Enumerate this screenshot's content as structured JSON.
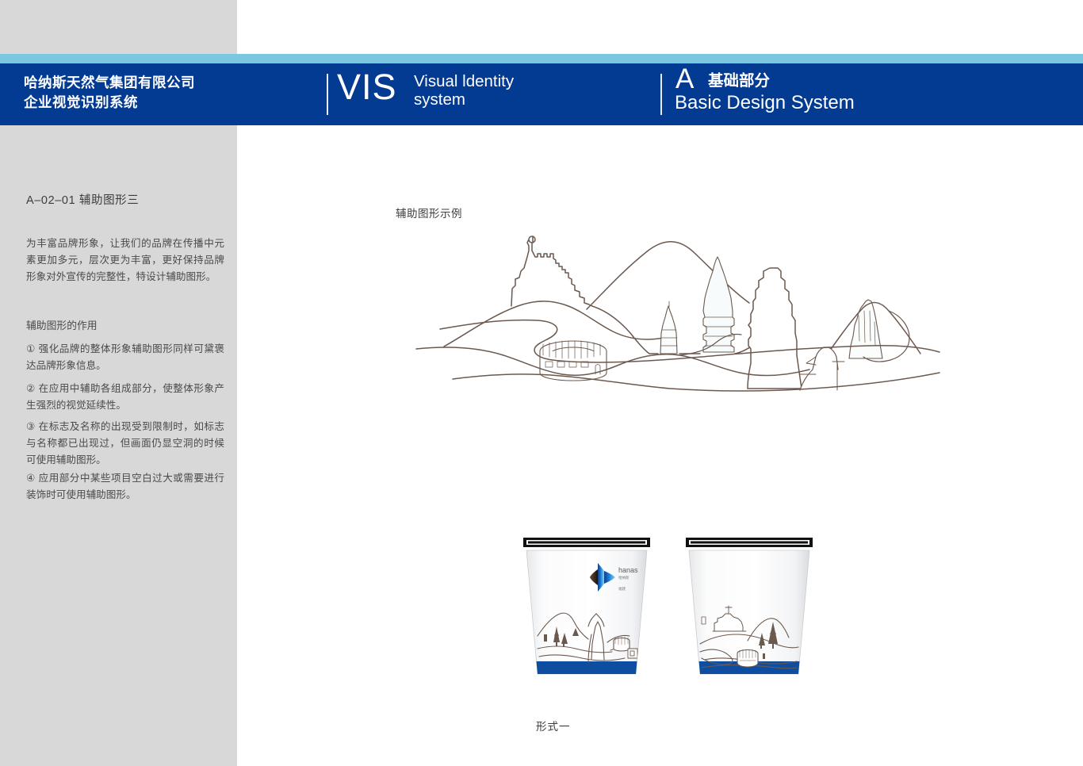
{
  "colors": {
    "navy": "#033b92",
    "light_blue": "#79c8e0",
    "panel_gray": "#d8d8d8",
    "line_brown": "#6b594e",
    "cup_band_blue": "#0d4ea0",
    "text_gray": "#4a4a4a"
  },
  "header": {
    "company_name": "哈纳斯天然气集团有限公司\n企业视觉识别系统",
    "vis_word": "VIS",
    "vis_subtitle": "Visual ldentity\nsystem",
    "section_letter": "A",
    "section_cn": "基础部分",
    "section_en": "Basic Design System"
  },
  "sidebar": {
    "page_code_title": "A–02–01 辅助图形三",
    "intro": "为丰富品牌形象，让我们的品牌在传播中元素更加多元，层次更为丰富，更好保持品牌形象对外宣传的完整性，特设计辅助图形。",
    "role_heading": "辅助图形的作用",
    "items": [
      "①  强化品牌的整体形象辅助图形同样可黛褒达品牌形象信息。",
      "②  在应用中辅助各组成部分，使整体形象产生强烈的视觉延续性。",
      "③  在标志及名称的出现受到限制时，如标志与名称都已出现过，但画面仍显空洞的时候可使用辅助图形。",
      "④  应用部分中某些项目空白过大或需要进行装饰时可使用辅助图形。"
    ]
  },
  "main": {
    "example_label": "辅助图形示例",
    "caption": "形式一",
    "logo": {
      "wordmark": "hanas",
      "cn_name": "哈纳斯",
      "tagline": "福建"
    },
    "illustration": {
      "name": "ningxia-landmarks-line-art",
      "elements": [
        "castle-fort",
        "pagoda-tall",
        "pagoda-small",
        "mountain",
        "obelisk-tower",
        "amphitheater-ring",
        "rock-outcrop",
        "hills",
        "river-lines"
      ]
    },
    "cups": [
      {
        "name": "cup-front-with-logo",
        "has_logo": true,
        "has_landscape": true,
        "band": true
      },
      {
        "name": "cup-back-landscape-only",
        "has_logo": false,
        "has_landscape": true,
        "band": true
      }
    ]
  }
}
